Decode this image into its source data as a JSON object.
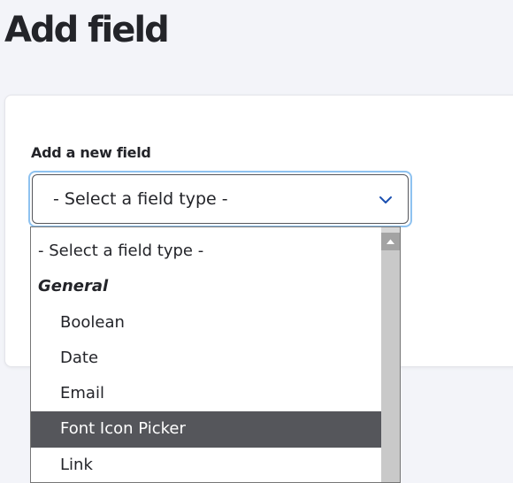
{
  "page": {
    "title": "Add field"
  },
  "form": {
    "field_label": "Add a new field",
    "select": {
      "selected": "- Select a field type -",
      "icon": "chevron-down-icon"
    },
    "dropdown": {
      "options": [
        {
          "label": "- Select a field type -",
          "kind": "placeholder"
        },
        {
          "label": "General",
          "kind": "group"
        },
        {
          "label": "Boolean",
          "kind": "option"
        },
        {
          "label": "Date",
          "kind": "option"
        },
        {
          "label": "Email",
          "kind": "option"
        },
        {
          "label": "Font Icon Picker",
          "kind": "option",
          "highlighted": true
        },
        {
          "label": "Link",
          "kind": "option"
        }
      ]
    }
  },
  "colors": {
    "accent_focus": "#8ec2f0",
    "chevron": "#1b4fb0",
    "highlight_bg": "#55565b",
    "text": "#232429"
  }
}
